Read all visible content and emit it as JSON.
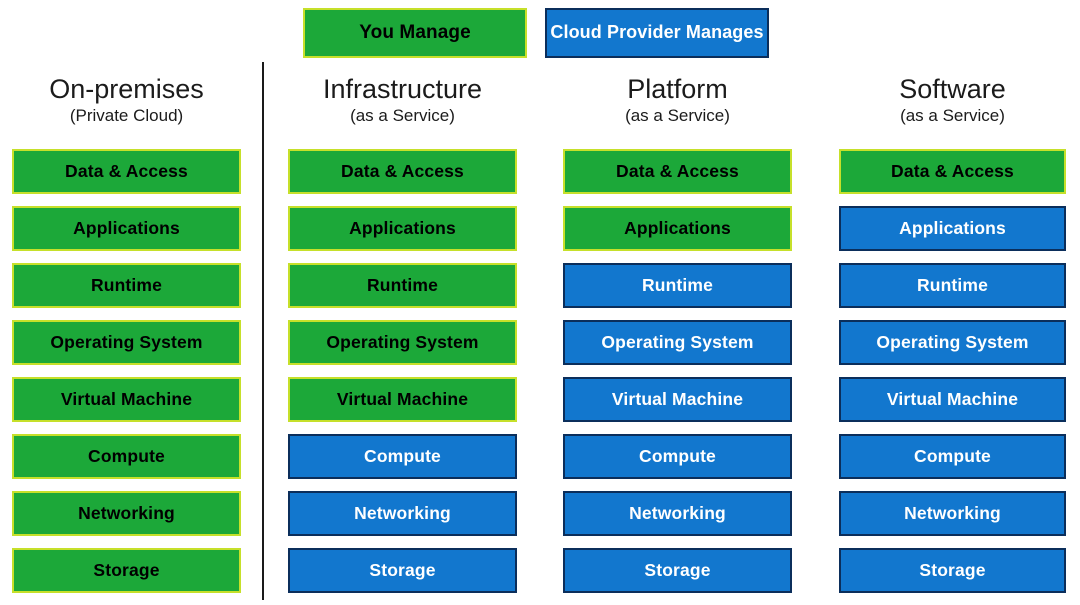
{
  "legend": {
    "you_manage": {
      "label": "You Manage",
      "color": "#1CA839",
      "border": "#C6E02A",
      "text_color": "#000000"
    },
    "cloud_provider_manages": {
      "label": "Cloud Provider Manages",
      "color": "#1277CE",
      "border": "#0B2E5B",
      "text_color": "#FFFFFF"
    }
  },
  "layer_names": [
    "Data & Access",
    "Applications",
    "Runtime",
    "Operating System",
    "Virtual Machine",
    "Compute",
    "Networking",
    "Storage"
  ],
  "columns": [
    {
      "title": "On-premises",
      "subtitle": "(Private Cloud)",
      "layers": [
        {
          "label": "Data & Access",
          "owner": "you"
        },
        {
          "label": "Applications",
          "owner": "you"
        },
        {
          "label": "Runtime",
          "owner": "you"
        },
        {
          "label": "Operating System",
          "owner": "you"
        },
        {
          "label": "Virtual Machine",
          "owner": "you"
        },
        {
          "label": "Compute",
          "owner": "you"
        },
        {
          "label": "Networking",
          "owner": "you"
        },
        {
          "label": "Storage",
          "owner": "you"
        }
      ]
    },
    {
      "title": "Infrastructure",
      "subtitle": "(as a Service)",
      "layers": [
        {
          "label": "Data & Access",
          "owner": "you"
        },
        {
          "label": "Applications",
          "owner": "you"
        },
        {
          "label": "Runtime",
          "owner": "you"
        },
        {
          "label": "Operating System",
          "owner": "you"
        },
        {
          "label": "Virtual Machine",
          "owner": "you"
        },
        {
          "label": "Compute",
          "owner": "provider"
        },
        {
          "label": "Networking",
          "owner": "provider"
        },
        {
          "label": "Storage",
          "owner": "provider"
        }
      ]
    },
    {
      "title": "Platform",
      "subtitle": "(as a Service)",
      "layers": [
        {
          "label": "Data & Access",
          "owner": "you"
        },
        {
          "label": "Applications",
          "owner": "you"
        },
        {
          "label": "Runtime",
          "owner": "provider"
        },
        {
          "label": "Operating System",
          "owner": "provider"
        },
        {
          "label": "Virtual Machine",
          "owner": "provider"
        },
        {
          "label": "Compute",
          "owner": "provider"
        },
        {
          "label": "Networking",
          "owner": "provider"
        },
        {
          "label": "Storage",
          "owner": "provider"
        }
      ]
    },
    {
      "title": "Software",
      "subtitle": "(as a Service)",
      "layers": [
        {
          "label": "Data & Access",
          "owner": "you"
        },
        {
          "label": "Applications",
          "owner": "provider"
        },
        {
          "label": "Runtime",
          "owner": "provider"
        },
        {
          "label": "Operating System",
          "owner": "provider"
        },
        {
          "label": "Virtual Machine",
          "owner": "provider"
        },
        {
          "label": "Compute",
          "owner": "provider"
        },
        {
          "label": "Networking",
          "owner": "provider"
        },
        {
          "label": "Storage",
          "owner": "provider"
        }
      ]
    }
  ]
}
